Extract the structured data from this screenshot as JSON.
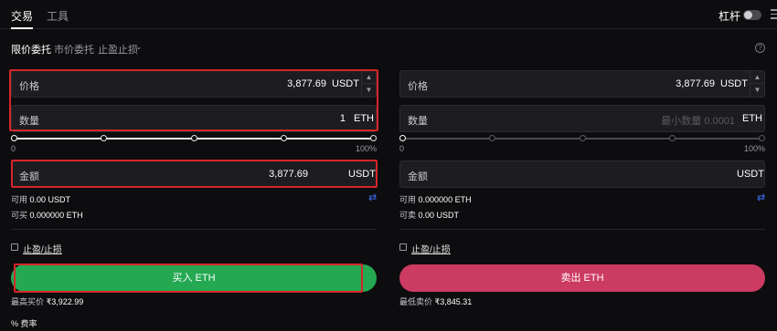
{
  "header": {
    "tabs": [
      "交易",
      "工具"
    ],
    "leverage_label": "杠杆"
  },
  "order_tabs": [
    "限价委托",
    "市价委托",
    "止盈止损"
  ],
  "help_icon": "?",
  "buy": {
    "price": {
      "label": "价格",
      "value": "3,877.69",
      "unit": "USDT"
    },
    "quantity": {
      "label": "数量",
      "value": "1",
      "unit": "ETH"
    },
    "slider": {
      "min_label": "0",
      "max_label": "100%",
      "level": 0
    },
    "amount": {
      "label": "金额",
      "value": "3,877.69",
      "unit": "USDT"
    },
    "available": {
      "label": "可用",
      "value": "0.00 USDT"
    },
    "can_trade": {
      "label": "可买",
      "value": "0.000000 ETH"
    },
    "tpsl_label": "止盈/止损",
    "button": "买入 ETH",
    "price_note": {
      "label": "最高买价",
      "value": "₹3,922.99"
    }
  },
  "sell": {
    "price": {
      "label": "价格",
      "value": "3,877.69",
      "unit": "USDT"
    },
    "quantity": {
      "label": "数量",
      "placeholder": "最小数量 0.0001",
      "unit": "ETH"
    },
    "slider": {
      "min_label": "0",
      "max_label": "100%",
      "level": 0
    },
    "amount": {
      "label": "金额",
      "unit": "USDT"
    },
    "available": {
      "label": "可用",
      "value": "0.000000 ETH"
    },
    "can_trade": {
      "label": "可卖",
      "value": "0.00 USDT"
    },
    "tpsl_label": "止盈/止损",
    "button": "卖出 ETH",
    "price_note": {
      "label": "最低卖价",
      "value": "₹3,845.31"
    }
  },
  "fee_label": "费率",
  "colors": {
    "buy": "#24a852",
    "sell": "#cc3b61",
    "highlight": "#d6262b",
    "swap": "#3b6cf0"
  }
}
